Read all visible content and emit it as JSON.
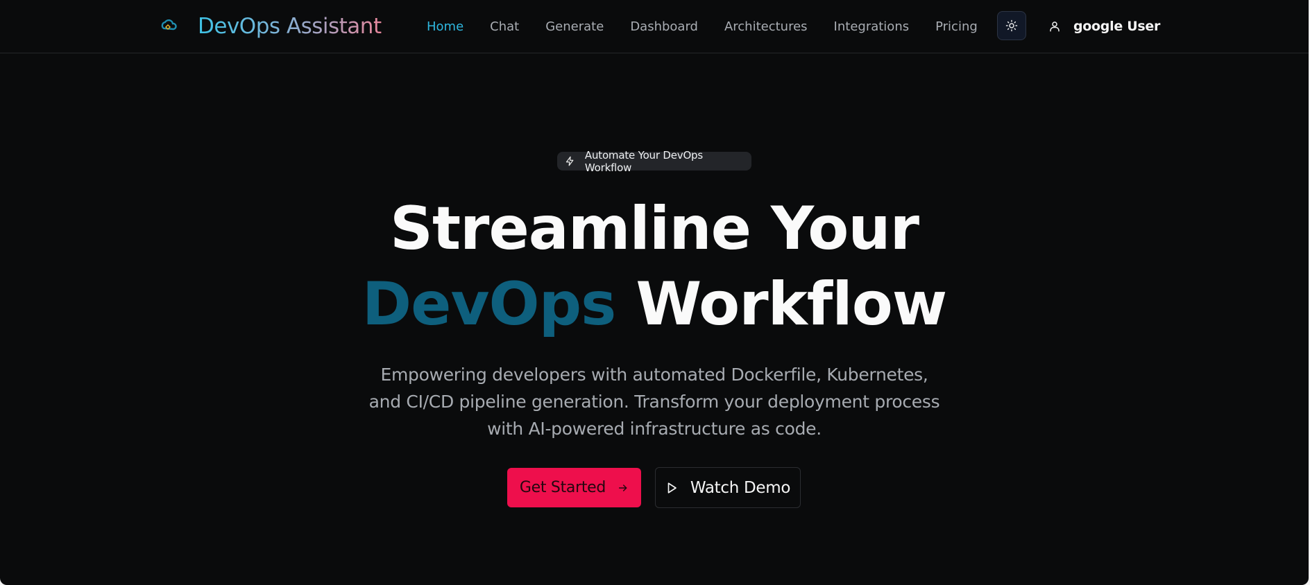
{
  "brand": {
    "name": "DevOps Assistant",
    "logo_icon": "cloud-devops-logo-icon"
  },
  "nav": {
    "links": [
      {
        "label": "Home",
        "active": true
      },
      {
        "label": "Chat",
        "active": false
      },
      {
        "label": "Generate",
        "active": false
      },
      {
        "label": "Dashboard",
        "active": false
      },
      {
        "label": "Architectures",
        "active": false
      },
      {
        "label": "Integrations",
        "active": false
      },
      {
        "label": "Pricing",
        "active": false
      }
    ],
    "theme_toggle_icon": "sun-icon",
    "user": {
      "name": "google User",
      "icon": "user-icon"
    }
  },
  "hero": {
    "badge": {
      "icon": "lightning-icon",
      "text": "Automate Your DevOps Workflow"
    },
    "headline_line1": "Streamline Your",
    "headline_accent": "DevOps",
    "headline_line2_rest": "Workflow",
    "description": "Empowering developers with automated Dockerfile, Kubernetes, and CI/CD pipeline generation. Transform your deployment process with AI-powered infrastructure as code.",
    "primary_cta": {
      "label": "Get Started",
      "icon": "arrow-right-icon"
    },
    "secondary_cta": {
      "label": "Watch Demo",
      "icon": "play-icon"
    }
  },
  "colors": {
    "background": "#0a0b0c",
    "nav_active": "#2fb8e0",
    "accent": "#0e5f7d",
    "primary_button": "#ee0f4c",
    "brand_gradient_start": "#3ec3e6",
    "brand_gradient_end": "#e7879c"
  }
}
